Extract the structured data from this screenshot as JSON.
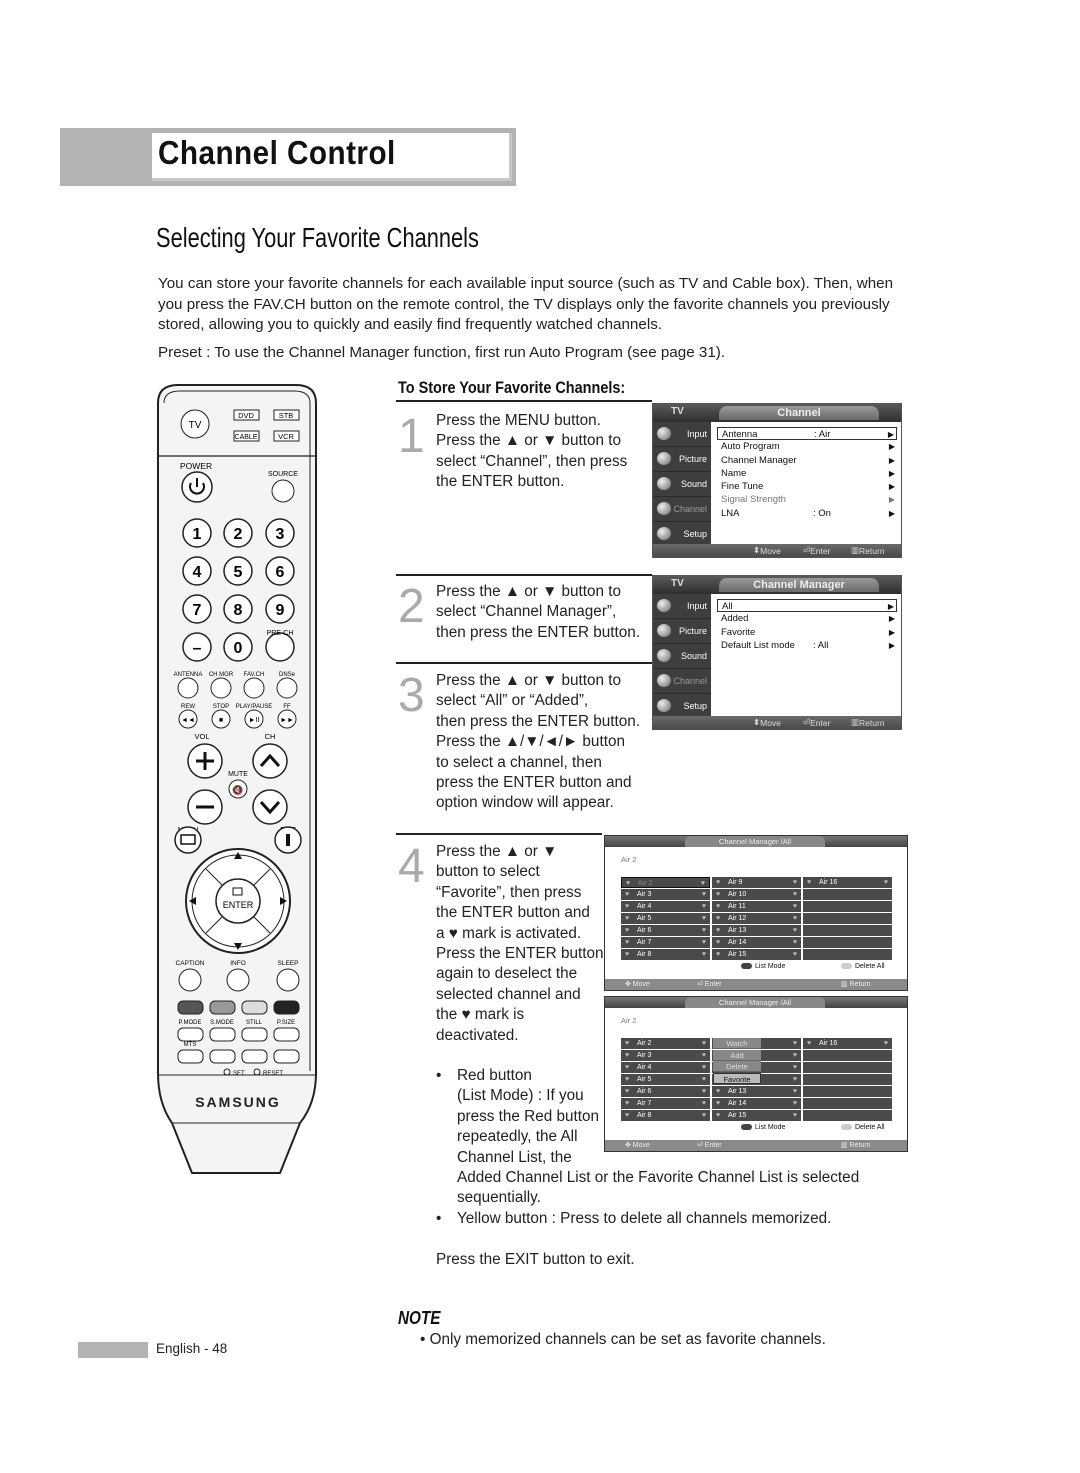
{
  "header": {
    "chapter_title": "Channel Control"
  },
  "section_title": "Selecting Your Favorite Channels",
  "intro": "You can store your favorite channels for each available input source (such as TV and Cable box). Then, when you press the FAV.CH button on the remote control, the TV displays only the favorite channels you previously stored, allowing you to quickly and easily find frequently watched channels.",
  "preset": "Preset : To use the Channel Manager function, first run Auto Program (see page 31).",
  "subsection_title": "To Store Your Favorite Channels:",
  "steps": [
    {
      "num": "1",
      "lines": [
        "Press the MENU button.",
        "Press the ▲ or ▼ button to",
        "select “Channel”, then press",
        "the ENTER button."
      ]
    },
    {
      "num": "2",
      "lines": [
        "Press the ▲ or ▼ button to",
        "select “Channel Manager”,",
        "then press the ENTER button."
      ]
    },
    {
      "num": "3",
      "lines": [
        "Press the ▲ or ▼ button to",
        "select “All” or “Added”,",
        "then press the ENTER button.",
        "Press the ▲/▼/◄/► button",
        "to select a channel, then",
        "press the ENTER button and",
        "option window will appear."
      ]
    },
    {
      "num": "4",
      "lines": [
        "Press the ▲ or ▼",
        "button to select",
        "“Favorite”, then press",
        "the ENTER button and",
        "a ♥ mark is activated.",
        "Press the ENTER button",
        "again to deselect the",
        "selected channel and",
        "the ♥ mark is",
        "deactivated."
      ]
    }
  ],
  "bullets": {
    "red": [
      "Red button",
      "(List Mode) : If you",
      "press the Red button",
      "repeatedly, the All",
      "Channel List, the",
      "Added Channel List or the Favorite Channel List is selected",
      "sequentially."
    ],
    "yellow": "Yellow button : Press to delete all channels memorized.",
    "exit": "Press the EXIT button to exit."
  },
  "note": {
    "heading": "NOTE",
    "text": "• Only memorized channels can be set as favorite channels."
  },
  "footer": {
    "page": "English - 48"
  },
  "remote": {
    "labels": {
      "tv": "TV",
      "dvd": "DVD",
      "stb": "STB",
      "cable": "CABLE",
      "vcr": "VCR",
      "power": "POWER",
      "source": "SOURCE",
      "digits": [
        "1",
        "2",
        "3",
        "4",
        "5",
        "6",
        "7",
        "8",
        "9",
        "–",
        "0",
        ""
      ],
      "prech": "PRE-CH",
      "func": [
        "ANTENNA",
        "CH MGR",
        "FAV.CH",
        "DNSe"
      ],
      "transport": [
        "REW",
        "STOP",
        "PLAY/PAUSE",
        "FF"
      ],
      "vol": "VOL",
      "ch": "CH",
      "mute": "MUTE",
      "menu": "MENU",
      "exit": "EXIT",
      "enter": "ENTER",
      "caption": "CAPTION",
      "info": "INFO",
      "sleep": "SLEEP",
      "color_keys": [
        "P.MODE",
        "S.MODE",
        "STILL",
        "P.SIZE"
      ],
      "mts": "MTS",
      "set": "SET",
      "reset": "RESET",
      "brand": "SAMSUNG"
    }
  },
  "menu_channel": {
    "tv": "TV",
    "title": "Channel",
    "side": [
      "Input",
      "Picture",
      "Sound",
      "Channel",
      "Setup"
    ],
    "items": [
      {
        "label": "Antenna",
        "value": ": Air"
      },
      {
        "label": "Auto Program",
        "value": ""
      },
      {
        "label": "Channel Manager",
        "value": ""
      },
      {
        "label": "Name",
        "value": ""
      },
      {
        "label": "Fine Tune",
        "value": ""
      },
      {
        "label": "Signal Strength",
        "value": ""
      },
      {
        "label": "LNA",
        "value": ": On"
      }
    ],
    "footer": {
      "move": "Move",
      "enter": "Enter",
      "return": "Return"
    }
  },
  "menu_manager": {
    "tv": "TV",
    "title": "Channel Manager",
    "side": [
      "Input",
      "Picture",
      "Sound",
      "Channel",
      "Setup"
    ],
    "items": [
      {
        "label": "All",
        "value": ""
      },
      {
        "label": "Added",
        "value": ""
      },
      {
        "label": "Favorite",
        "value": ""
      },
      {
        "label": "Default List mode",
        "value": ": All"
      }
    ],
    "footer": {
      "move": "Move",
      "enter": "Enter",
      "return": "Return"
    }
  },
  "channel_list": {
    "title": "Channel Manager /All",
    "current": "Air 2",
    "columns": [
      [
        "Air 2",
        "Air 3",
        "Air 4",
        "Air 5",
        "Air 6",
        "Air 7",
        "Air 8"
      ],
      [
        "Air 9",
        "Air 10",
        "Air 11",
        "Air 12",
        "Air 13",
        "Air 14",
        "Air 15"
      ],
      [
        "Air 16",
        "",
        "",
        "",
        "",
        "",
        ""
      ]
    ],
    "list_mode": "List Mode",
    "delete_all": "Delete All",
    "footer": {
      "move": "Move",
      "enter": "Enter",
      "return": "Return"
    },
    "options": [
      "Watch",
      "Add",
      "Delete",
      "Favorite"
    ],
    "colors": {
      "red_key": "#444444",
      "yellow_key": "#cccccc"
    }
  }
}
